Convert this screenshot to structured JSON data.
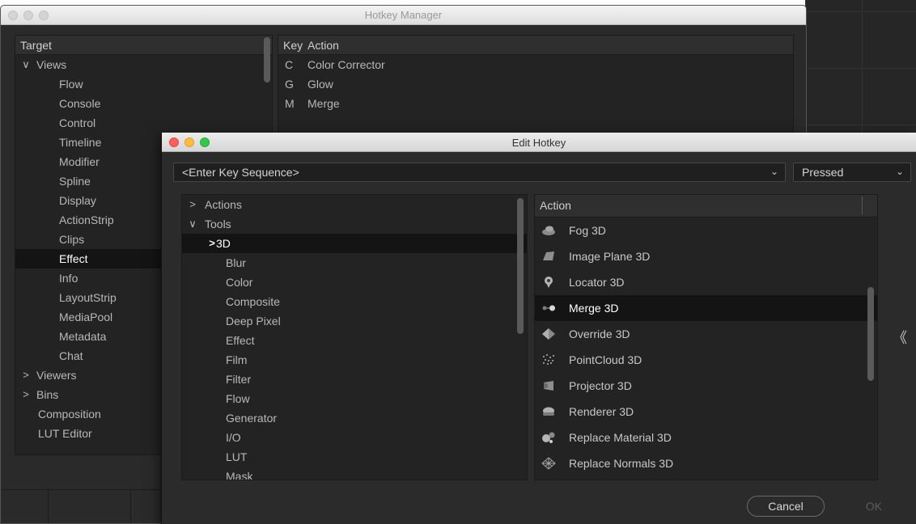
{
  "hotkey_manager": {
    "title": "Hotkey Manager",
    "target_header": "Target",
    "tree": [
      {
        "label": "Views",
        "level": 0,
        "expander": "expanded"
      },
      {
        "label": "Flow",
        "level": 2
      },
      {
        "label": "Console",
        "level": 2
      },
      {
        "label": "Control",
        "level": 2
      },
      {
        "label": "Timeline",
        "level": 2
      },
      {
        "label": "Modifier",
        "level": 2
      },
      {
        "label": "Spline",
        "level": 2
      },
      {
        "label": "Display",
        "level": 2
      },
      {
        "label": "ActionStrip",
        "level": 2
      },
      {
        "label": "Clips",
        "level": 2
      },
      {
        "label": "Effect",
        "level": 2,
        "selected": true
      },
      {
        "label": "Info",
        "level": 2
      },
      {
        "label": "LayoutStrip",
        "level": 2
      },
      {
        "label": "MediaPool",
        "level": 2
      },
      {
        "label": "Metadata",
        "level": 2
      },
      {
        "label": "Chat",
        "level": 2
      },
      {
        "label": "Viewers",
        "level": 0,
        "expander": "collapsed"
      },
      {
        "label": "Bins",
        "level": 0,
        "expander": "collapsed"
      },
      {
        "label": "Composition",
        "level": 1
      },
      {
        "label": "LUT Editor",
        "level": 1
      }
    ],
    "key_table": {
      "headers": {
        "key": "Key",
        "action": "Action"
      },
      "rows": [
        {
          "key": "C",
          "action": "Color Corrector"
        },
        {
          "key": "G",
          "action": "Glow"
        },
        {
          "key": "M",
          "action": "Merge"
        }
      ]
    }
  },
  "edit_hotkey": {
    "title": "Edit Hotkey",
    "key_sequence": "<Enter Key Sequence>",
    "trigger": "Pressed",
    "categories": [
      {
        "label": "Actions",
        "level": 0,
        "expander": "collapsed"
      },
      {
        "label": "Tools",
        "level": 0,
        "expander": "expanded"
      },
      {
        "label": "3D",
        "level": 1,
        "expander": "collapsed",
        "selected": true
      },
      {
        "label": "Blur",
        "level": 2
      },
      {
        "label": "Color",
        "level": 2
      },
      {
        "label": "Composite",
        "level": 2
      },
      {
        "label": "Deep Pixel",
        "level": 2
      },
      {
        "label": "Effect",
        "level": 2
      },
      {
        "label": "Film",
        "level": 2
      },
      {
        "label": "Filter",
        "level": 2
      },
      {
        "label": "Flow",
        "level": 2
      },
      {
        "label": "Generator",
        "level": 2
      },
      {
        "label": "I/O",
        "level": 2
      },
      {
        "label": "LUT",
        "level": 2
      },
      {
        "label": "Mask",
        "level": 2
      }
    ],
    "action_header": "Action",
    "actions": [
      {
        "label": "Fog 3D",
        "icon": "fog-3d-icon"
      },
      {
        "label": "Image Plane 3D",
        "icon": "image-plane-3d-icon"
      },
      {
        "label": "Locator 3D",
        "icon": "locator-3d-icon"
      },
      {
        "label": "Merge 3D",
        "icon": "merge-3d-icon",
        "selected": true
      },
      {
        "label": "Override 3D",
        "icon": "override-3d-icon"
      },
      {
        "label": "PointCloud 3D",
        "icon": "pointcloud-3d-icon"
      },
      {
        "label": "Projector 3D",
        "icon": "projector-3d-icon"
      },
      {
        "label": "Renderer 3D",
        "icon": "renderer-3d-icon"
      },
      {
        "label": "Replace Material 3D",
        "icon": "replace-material-3d-icon"
      },
      {
        "label": "Replace Normals 3D",
        "icon": "replace-normals-3d-icon"
      }
    ],
    "collapse_glyph": "《",
    "cancel_label": "Cancel",
    "ok_label": "OK"
  }
}
